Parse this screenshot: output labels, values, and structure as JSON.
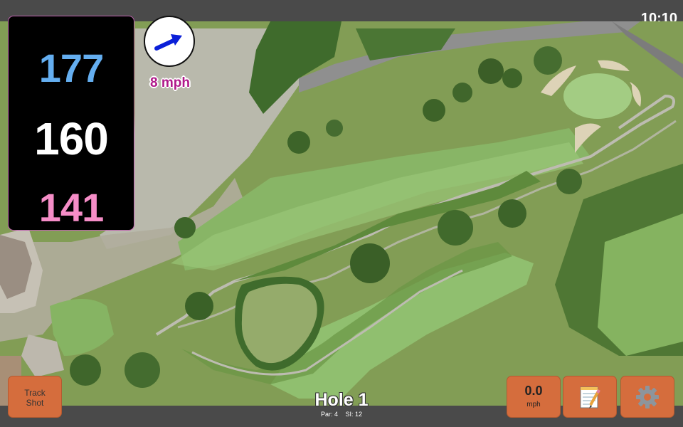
{
  "status": {
    "time": "10:10"
  },
  "distances": {
    "back": "177",
    "middle": "160",
    "front": "141"
  },
  "wind": {
    "speed_label": "8 mph",
    "icon": "arrow-icon"
  },
  "buttons": {
    "track_shot_line1": "Track",
    "track_shot_line2": "Shot",
    "speed_value": "0.0",
    "speed_unit": "mph",
    "notes_icon": "notepad-icon",
    "settings_icon": "gear-icon"
  },
  "hole": {
    "title": "Hole 1",
    "par_label": "Par: 4",
    "si_label": "SI: 12"
  },
  "colors": {
    "back": "#64aef0",
    "middle": "#ffffff",
    "front": "#f58dc7",
    "button": "#d56d3d",
    "wind_text": "#b0188a"
  }
}
